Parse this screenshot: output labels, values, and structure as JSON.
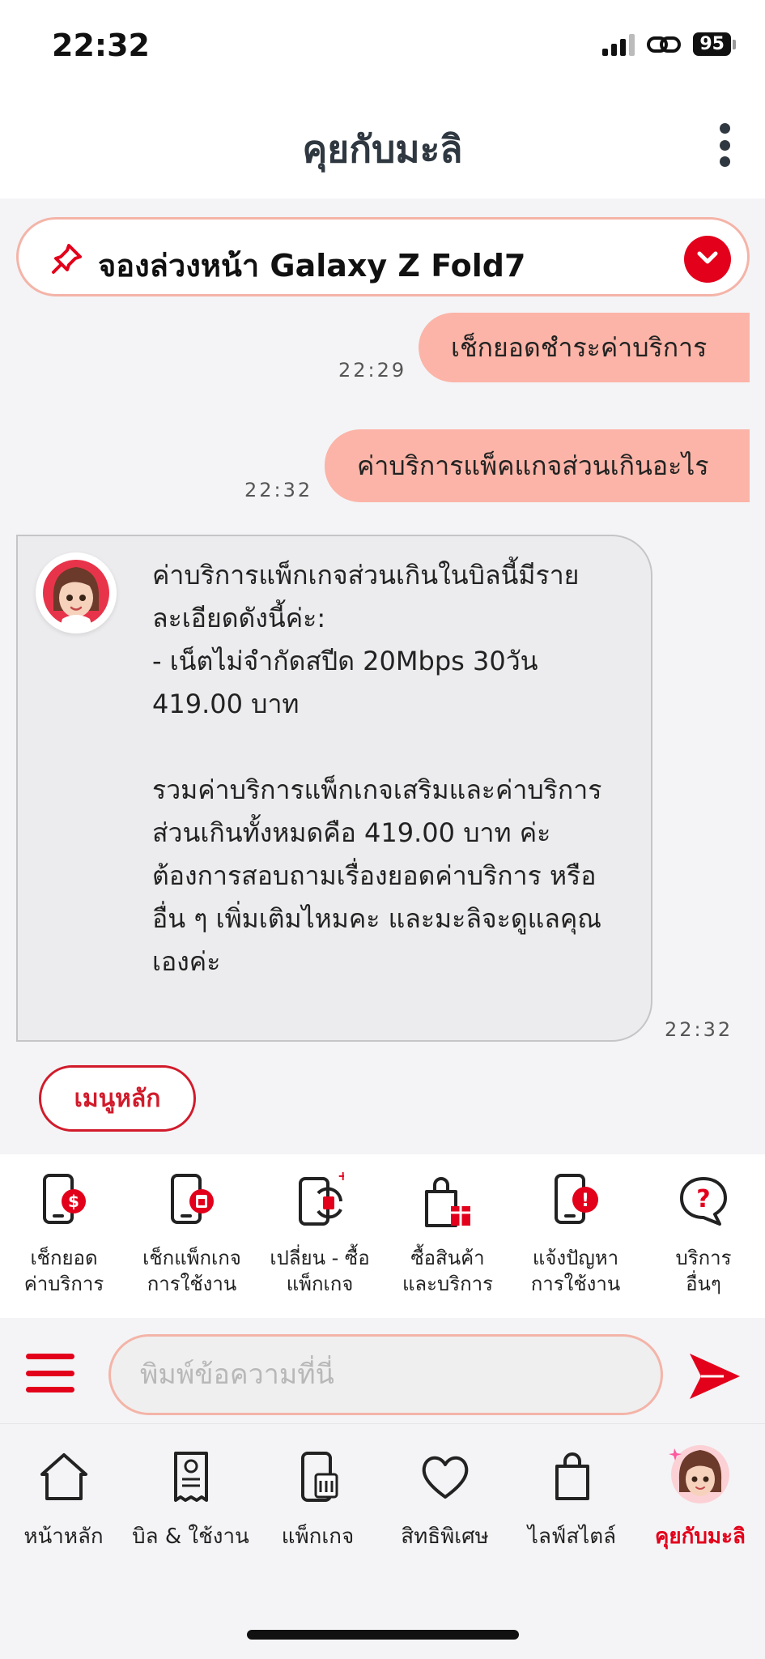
{
  "status_bar": {
    "time": "22:32",
    "battery": "95"
  },
  "header": {
    "title": "คุยกับมะลิ"
  },
  "pinned": {
    "text": "จองล่วงหน้า Galaxy Z Fold7"
  },
  "messages": [
    {
      "from": "user",
      "text": "เช็กยอดชำระค่าบริการ",
      "time": "22:29"
    },
    {
      "from": "user",
      "text": "ค่าบริการแพ็คแกจส่วนเกินอะไร",
      "time": "22:32"
    },
    {
      "from": "bot",
      "text": "ค่าบริการแพ็กเกจส่วนเกินในบิลนี้มีรายละเอียดดังนี้ค่ะ:\n- เน็ตไม่จำกัดสปีด 20Mbps 30วัน 419.00 บาท\n\nรวมค่าบริการแพ็กเกจเสริมและค่าบริการส่วนเกินทั้งหมดคือ 419.00 บาท ค่ะ\nต้องการสอบถามเรื่องยอดค่าบริการ หรือ อื่น ๆ เพิ่มเติมไหมคะ และมะลิจะดูแลคุณเองค่ะ",
      "time": "22:32"
    }
  ],
  "main_menu_label": "เมนูหลัก",
  "quick_menu": [
    {
      "label": "เช็กยอด\nค่าบริการ",
      "icon": "phone-bill-icon"
    },
    {
      "label": "เช็กแพ็กเกจ\nการใช้งาน",
      "icon": "phone-sim-icon"
    },
    {
      "label": "เปลี่ยน - ซื้อ\nแพ็กเกจ",
      "icon": "phone-swap-icon"
    },
    {
      "label": "ซื้อสินค้า\nและบริการ",
      "icon": "shopping-gift-icon"
    },
    {
      "label": "แจ้งปัญหา\nการใช้งาน",
      "icon": "phone-alert-icon"
    },
    {
      "label": "บริการ\nอื่นๆ",
      "icon": "question-bubble-icon"
    }
  ],
  "input": {
    "placeholder": "พิมพ์ข้อความที่นี่"
  },
  "bottom_nav": [
    {
      "label": "หน้าหลัก",
      "icon": "home-icon"
    },
    {
      "label": "บิล & ใช้งาน",
      "icon": "bill-icon"
    },
    {
      "label": "แพ็กเกจ",
      "icon": "package-phone-icon"
    },
    {
      "label": "สิทธิพิเศษ",
      "icon": "heart-icon"
    },
    {
      "label": "ไลฟ์สไตล์",
      "icon": "shopping-bag-icon"
    },
    {
      "label": "คุยกับมะลิ",
      "icon": "mali-avatar-icon",
      "active": true
    }
  ],
  "colors": {
    "accent": "#e3001b",
    "user_bubble": "#fbb4a7",
    "bot_bubble": "#ececee"
  }
}
